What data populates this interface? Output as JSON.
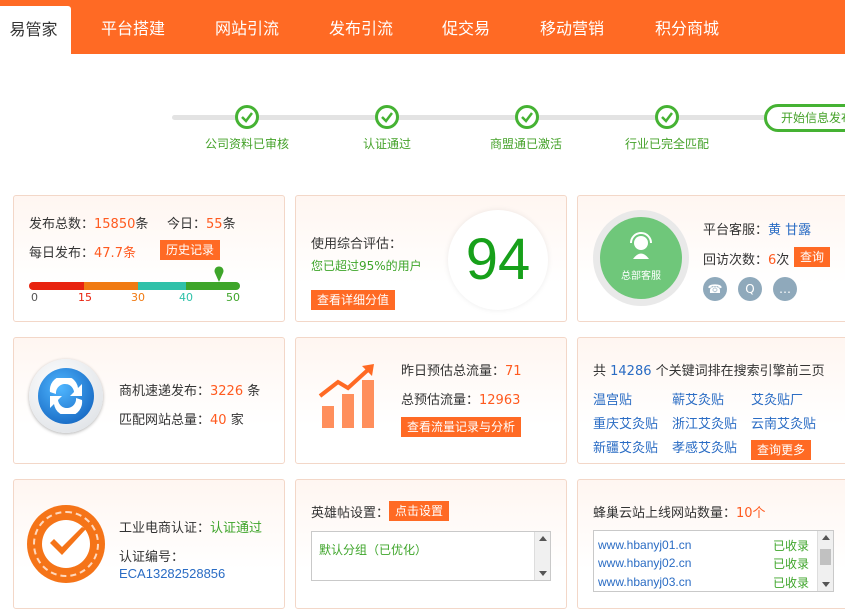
{
  "nav": {
    "tabs": [
      {
        "label": "易管家",
        "active": true
      },
      {
        "label": "平台搭建"
      },
      {
        "label": "网站引流"
      },
      {
        "label": "发布引流"
      },
      {
        "label": "促交易"
      },
      {
        "label": "移动营销"
      },
      {
        "label": "积分商城"
      }
    ]
  },
  "steps": [
    {
      "label": "公司资料已审核"
    },
    {
      "label": "认证通过"
    },
    {
      "label": "商盟通已激活"
    },
    {
      "label": "行业已完全匹配"
    }
  ],
  "start_button": "开始信息发布",
  "publish": {
    "total_label": "发布总数：",
    "total_value": "15850",
    "total_unit": "条",
    "today_label": "今日：",
    "today_value": "55",
    "today_unit": "条",
    "daily_label": "每日发布：",
    "daily_value": "47.7条",
    "history_button": "历史记录",
    "scale_ticks": [
      "0",
      "15",
      "30",
      "40",
      "50"
    ],
    "level": 47.7,
    "colors": {
      "red": "#e8230f",
      "orange": "#f07a12",
      "teal": "#2fc1a9",
      "green": "#3ea52a"
    }
  },
  "evaluation": {
    "label": "使用综合评估：",
    "desc": "您已超过95%的用户",
    "score": "94",
    "detail_button": "查看详细分值"
  },
  "service": {
    "avatar_label": "总部客服",
    "agent_label": "平台客服：",
    "agent_name": "黄 甘露",
    "visits_label": "回访次数：",
    "visits_value": "6",
    "visits_unit": "次",
    "query_button": "查询",
    "contact_icons": [
      "phone-icon",
      "qq-icon",
      "chat-icon"
    ]
  },
  "express": {
    "publish_label": "商机速递发布：",
    "publish_value": "3226",
    "publish_unit": " 条",
    "match_label": "匹配网站总量：",
    "match_value": "40",
    "match_unit": " 家"
  },
  "traffic": {
    "yesterday_label": "昨日预估总流量：",
    "yesterday_value": "71",
    "total_label": "总预估流量：",
    "total_value": "12963",
    "button": "查看流量记录与分析"
  },
  "keywords": {
    "prefix": "共 ",
    "count": "14286",
    "suffix": " 个关键词排在搜索引擎前三页",
    "items": [
      "温宫贴",
      "蕲艾灸贴",
      "艾灸贴厂",
      "重庆艾灸贴",
      "浙江艾灸贴",
      "云南艾灸贴",
      "新疆艾灸贴",
      "孝感艾灸贴"
    ],
    "more_button": "查询更多"
  },
  "certification": {
    "auth_label": "工业电商认证：",
    "auth_value": "认证通过",
    "number_label": "认证编号：",
    "number_value": "ECA13282528856"
  },
  "hero": {
    "label": "英雄帖设置：",
    "button": "点击设置",
    "option": "默认分组（已优化）"
  },
  "cloud": {
    "label": "蜂巢云站上线网站数量：",
    "count": "10个",
    "sites": [
      {
        "url": "www.hbanyj01.cn",
        "status": "已收录"
      },
      {
        "url": "www.hbanyj02.cn",
        "status": "已收录"
      },
      {
        "url": "www.hbanyj03.cn",
        "status": "已收录"
      }
    ]
  }
}
